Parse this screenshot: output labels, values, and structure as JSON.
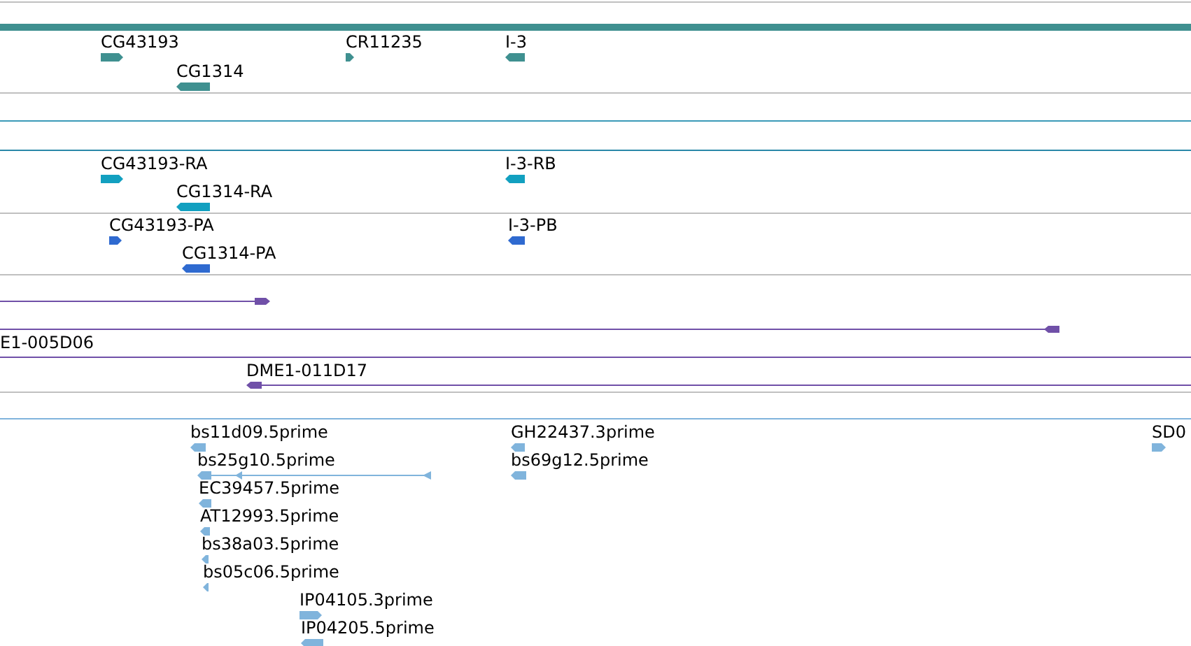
{
  "tracks": [
    {
      "color": "#3f9090",
      "features": [
        {
          "kind": "gene",
          "label": "CG43193",
          "forward": true
        },
        {
          "kind": "gene",
          "label": "CR11235",
          "forward": true
        },
        {
          "kind": "gene",
          "label": "I-3",
          "forward": false
        },
        {
          "kind": "gene",
          "label": "CG1314",
          "forward": false
        }
      ]
    },
    {
      "color": "#3a9ab8"
    },
    {
      "color": "#2a88a8"
    },
    {
      "color": "#12a0c0",
      "features": [
        {
          "kind": "gene",
          "label": "CG43193-RA",
          "forward": true
        },
        {
          "kind": "gene",
          "label": "CG1314-RA",
          "forward": false
        },
        {
          "kind": "gene",
          "label": "I-3-RB",
          "forward": false
        }
      ]
    },
    {
      "color": "#2f6ad0",
      "features": [
        {
          "kind": "gene",
          "label": "CG43193-PA",
          "forward": true
        },
        {
          "kind": "gene",
          "label": "CG1314-PA",
          "forward": false
        },
        {
          "kind": "gene",
          "label": "I-3-PB",
          "forward": false
        }
      ]
    },
    {
      "color": "#7050a8",
      "features": [
        {
          "kind": "clone",
          "forward": true
        },
        {
          "kind": "clone",
          "label": "E1-005D06",
          "forward": false
        }
      ]
    },
    {
      "color": "#7050a8",
      "features": [
        {
          "kind": "clone",
          "label": "DME1-011D17",
          "forward": false
        }
      ]
    },
    {
      "color": "#80b4dc"
    },
    {
      "color": "#80b4dc",
      "features": [
        {
          "kind": "gene",
          "label": "bs11d09.5prime",
          "forward": false
        },
        {
          "kind": "gene",
          "label": "bs25g10.5prime",
          "forward": false
        },
        {
          "kind": "gene",
          "label": "EC39457.5prime",
          "forward": false
        },
        {
          "kind": "gene",
          "label": "AT12993.5prime",
          "forward": false
        },
        {
          "kind": "gene",
          "label": "bs38a03.5prime",
          "forward": false
        },
        {
          "kind": "gene",
          "label": "bs05c06.5prime",
          "forward": false
        },
        {
          "kind": "gene",
          "label": "IP04105.3prime",
          "forward": true
        },
        {
          "kind": "gene",
          "label": "IP04205.5prime",
          "forward": false
        },
        {
          "kind": "gene",
          "label": "GH22437.3prime",
          "forward": false
        },
        {
          "kind": "gene",
          "label": "bs69g12.5prime",
          "forward": false
        },
        {
          "kind": "gene",
          "label": "SD0",
          "forward": true
        }
      ]
    }
  ]
}
